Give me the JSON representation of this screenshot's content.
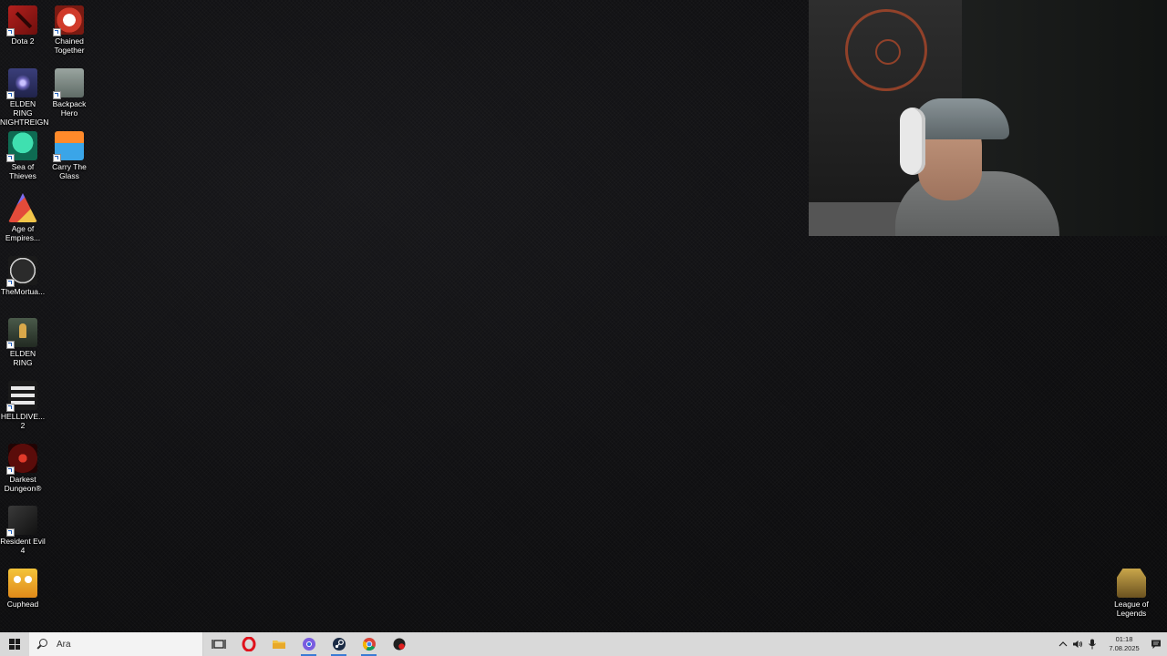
{
  "desktop_icons": [
    {
      "label": "Dota 2",
      "icon": "dota2-icon"
    },
    {
      "label": "Chained Together",
      "icon": "chained-together-icon"
    },
    {
      "label": "ELDEN RING NIGHTREIGN",
      "icon": "elden-ring-nightreign-icon"
    },
    {
      "label": "Backpack Hero",
      "icon": "backpack-hero-icon"
    },
    {
      "label": "Sea of Thieves",
      "icon": "sea-of-thieves-icon"
    },
    {
      "label": "Carry The Glass",
      "icon": "carry-the-glass-icon"
    },
    {
      "label": "Age of Empires...",
      "icon": "age-of-empires-icon"
    },
    {
      "label": "TheMortua...",
      "icon": "the-mortuary-icon"
    },
    {
      "label": "ELDEN RING",
      "icon": "elden-ring-icon"
    },
    {
      "label": "HELLDIVE... 2",
      "icon": "helldivers-2-icon"
    },
    {
      "label": "Darkest Dungeon®",
      "icon": "darkest-dungeon-icon"
    },
    {
      "label": "Resident Evil 4",
      "icon": "resident-evil-4-icon"
    },
    {
      "label": "Cuphead",
      "icon": "cuphead-icon"
    },
    {
      "label": "League of Legends",
      "icon": "league-of-legends-icon"
    }
  ],
  "taskbar": {
    "search_placeholder": "Ara",
    "apps": [
      {
        "name": "task-view",
        "icon": "task-view-icon"
      },
      {
        "name": "opera",
        "icon": "opera-icon"
      },
      {
        "name": "file-explorer",
        "icon": "folder-icon"
      },
      {
        "name": "chrome-profile",
        "icon": "chrome-profile-icon"
      },
      {
        "name": "steam",
        "icon": "steam-icon"
      },
      {
        "name": "chrome",
        "icon": "chrome-icon"
      },
      {
        "name": "record-app",
        "icon": "record-app-icon"
      }
    ],
    "clock": {
      "time": "01:18",
      "date": "7.08.2025"
    }
  },
  "colors": {
    "desktop_bg": "#0e0e0f",
    "taskbar_bg": "#d9d9d9",
    "accent": "#3a7bd5"
  }
}
